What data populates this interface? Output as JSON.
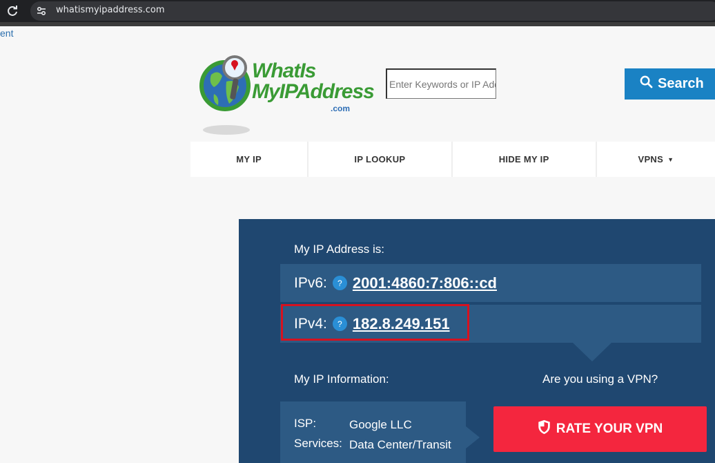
{
  "browser": {
    "url": "whatismyipaddress.com",
    "reload_icon": "reload-icon",
    "site_settings_icon": "tune-icon"
  },
  "page": {
    "left_link": "ent"
  },
  "logo": {
    "line1": "WhatIs",
    "line2": "MyIPAddress",
    "line3": ".com",
    "brand_green": "#3a9b35",
    "brand_blue": "#2e6eb5"
  },
  "search": {
    "placeholder": "Enter Keywords or IP Address",
    "button_label": "Search",
    "icon": "search-icon",
    "color": "#1a82c4"
  },
  "nav": {
    "items": [
      {
        "label": "MY IP"
      },
      {
        "label": "IP LOOKUP"
      },
      {
        "label": "HIDE MY IP"
      },
      {
        "label": "VPNS",
        "caret": "▼"
      }
    ]
  },
  "ip_panel": {
    "title": "My IP Address is:",
    "ipv6_label": "IPv6:",
    "ipv6_value": "2001:4860:7:806::cd",
    "ipv4_label": "IPv4:",
    "ipv4_value": "182.8.249.151",
    "help_glyph": "?",
    "bg_color": "#1f4770",
    "row_color": "#2d5a84"
  },
  "info": {
    "title": "My IP Information:",
    "isp_label": "ISP:",
    "isp_value": "Google LLC",
    "services_label": "Services:",
    "services_value": "Data Center/Transit"
  },
  "vpn": {
    "question": "Are you using a VPN?",
    "button_label": "RATE YOUR VPN",
    "button_icon": "shield-icon",
    "button_color": "#f4263e"
  }
}
